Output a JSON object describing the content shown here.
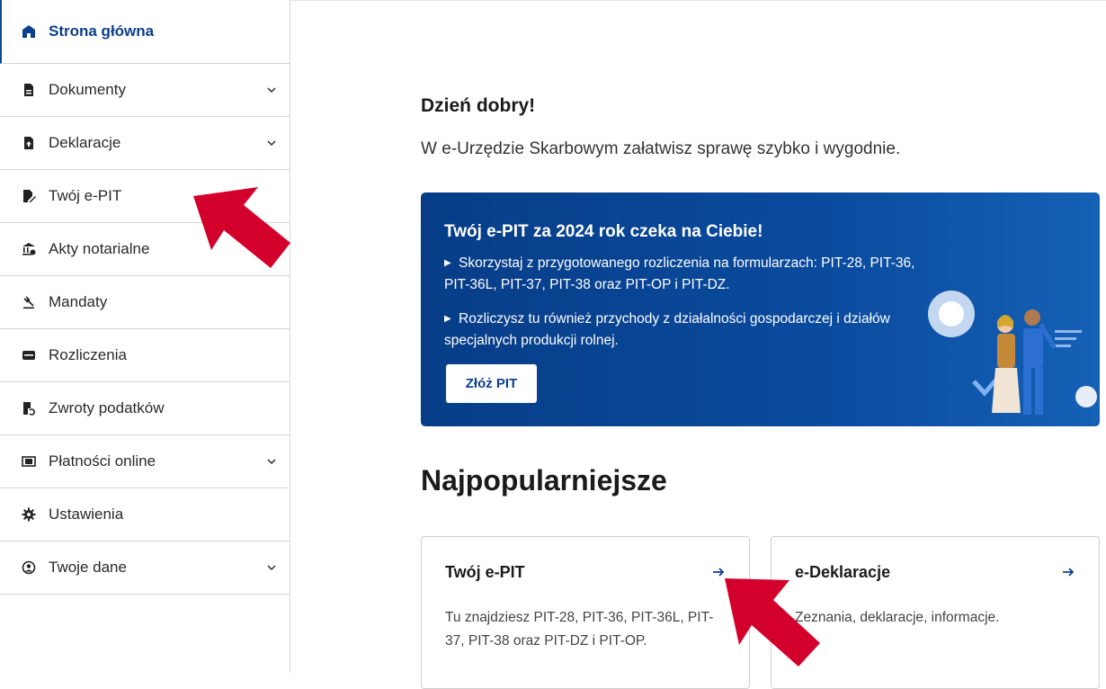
{
  "sidebar": {
    "items": [
      {
        "label": "Strona główna",
        "icon": "home-icon",
        "active": true,
        "expandable": false
      },
      {
        "label": "Dokumenty",
        "icon": "document-icon",
        "active": false,
        "expandable": true
      },
      {
        "label": "Deklaracje",
        "icon": "declaration-upload-icon",
        "active": false,
        "expandable": true
      },
      {
        "label": "Twój e-PIT",
        "icon": "pencil-doc-icon",
        "active": false,
        "expandable": false
      },
      {
        "label": "Akty notarialne",
        "icon": "notary-building-icon",
        "active": false,
        "expandable": false
      },
      {
        "label": "Mandaty",
        "icon": "gavel-icon",
        "active": false,
        "expandable": false
      },
      {
        "label": "Rozliczenia",
        "icon": "wallet-icon",
        "active": false,
        "expandable": false
      },
      {
        "label": "Zwroty podatków",
        "icon": "tax-refund-icon",
        "active": false,
        "expandable": false
      },
      {
        "label": "Płatności online",
        "icon": "online-payment-icon",
        "active": false,
        "expandable": true
      },
      {
        "label": "Ustawienia",
        "icon": "gear-icon",
        "active": false,
        "expandable": false
      },
      {
        "label": "Twoje dane",
        "icon": "user-circle-icon",
        "active": false,
        "expandable": true
      }
    ]
  },
  "main": {
    "greeting_title": "Dzień dobry!",
    "greeting_subtitle": "W e-Urzędzie Skarbowym załatwisz sprawę szybko i wygodnie.",
    "banner": {
      "title": "Twój e-PIT za 2024 rok czeka na Ciebie!",
      "bullet1": "Skorzystaj z przygotowanego rozliczenia na formularzach: PIT-28, PIT-36, PIT-36L, PIT-37, PIT-38 oraz PIT-OP i PIT-DZ.",
      "bullet2": "Rozliczysz tu również przychody z działalności gospodarczej i działów specjalnych produkcji rolnej.",
      "button_label": "Złóż PIT"
    },
    "popular_title": "Najpopularniejsze",
    "cards": [
      {
        "title": "Twój e-PIT",
        "description": "Tu znajdziesz PIT-28, PIT-36, PIT-36L, PIT-37, PIT-38 oraz PIT-DZ i PIT-OP."
      },
      {
        "title": "e-Deklaracje",
        "description": "Zeznania, deklaracje, informacje."
      }
    ]
  },
  "colors": {
    "brand_blue": "#0b3f8b",
    "banner_blue": "#0a4b9e",
    "annotation_red": "#d3002b"
  }
}
